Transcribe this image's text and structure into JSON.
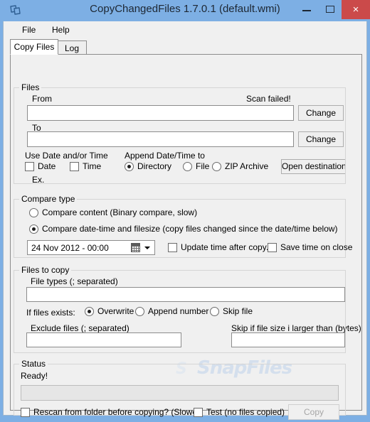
{
  "window": {
    "title": "CopyChangedFiles 1.7.0.1 (default.wmi)",
    "icon": "copy-files-icon",
    "minimize_label": "–",
    "maximize_label": "❑",
    "close_label": "×",
    "titlebar_color": "#7dafe4",
    "close_button_color": "#cb4a4a",
    "client_background": "#f0f0f0"
  },
  "menu": {
    "items": [
      {
        "label": "File"
      },
      {
        "label": "Help"
      }
    ]
  },
  "tabs": [
    {
      "label": "Copy Files",
      "active": true
    },
    {
      "label": "Log",
      "active": false
    }
  ],
  "watermark": {
    "mark": "S",
    "text": "SnapFiles"
  },
  "files_group": {
    "title": "Files",
    "from_label": "From",
    "from_value": "",
    "from_placeholder": "",
    "scan_status": "Scan failed!",
    "from_change_button": "Change",
    "to_label": "To",
    "to_value": "",
    "to_placeholder": "",
    "to_change_button": "Change",
    "use_date_time_label": "Use Date and/or Time",
    "append_to_label": "Append Date/Time to",
    "checkboxes": [
      {
        "label": "Date",
        "checked": false
      },
      {
        "label": "Time",
        "checked": false
      }
    ],
    "append_options": [
      {
        "label": "Directory",
        "checked": true
      },
      {
        "label": "File",
        "checked": false
      },
      {
        "label": "ZIP Archive",
        "checked": false
      }
    ],
    "open_destination_button": "Open destination",
    "example_label": "Ex.",
    "example_value": ""
  },
  "compare_group": {
    "title": "Compare type",
    "options": [
      {
        "label": "Compare content (Binary compare, slow)",
        "checked": false
      },
      {
        "label": "Compare date-time and filesize (copy files changed since the date/time below)",
        "checked": true
      }
    ],
    "date_value": "24  Nov  2012  -  00:00",
    "update_time_checkbox": {
      "label": "Update time after copy.",
      "checked": false
    },
    "save_time_checkbox": {
      "label": "Save time on close",
      "checked": false
    }
  },
  "files_to_copy_group": {
    "title": "Files to copy",
    "file_types_label": "File types (; separated)",
    "file_types_value": "",
    "if_exists_label": "If files exists:",
    "if_exists_options": [
      {
        "label": "Overwrite",
        "checked": true
      },
      {
        "label": "Append number",
        "checked": false
      },
      {
        "label": "Skip file",
        "checked": false
      }
    ],
    "exclude_files_label": "Exclude files (; separated)",
    "exclude_files_value": "",
    "skip_size_label": "Skip if file size i larger than (bytes)",
    "skip_size_value": ""
  },
  "status_group": {
    "title": "Status",
    "status_text": "Ready!",
    "progress_percent": 0,
    "rescan_checkbox": {
      "label": "Rescan from folder before copying? (Slower)",
      "checked": false
    },
    "test_checkbox": {
      "label": "Test (no files copied)",
      "checked": false
    },
    "copy_button": {
      "label": "Copy",
      "enabled": false
    }
  }
}
